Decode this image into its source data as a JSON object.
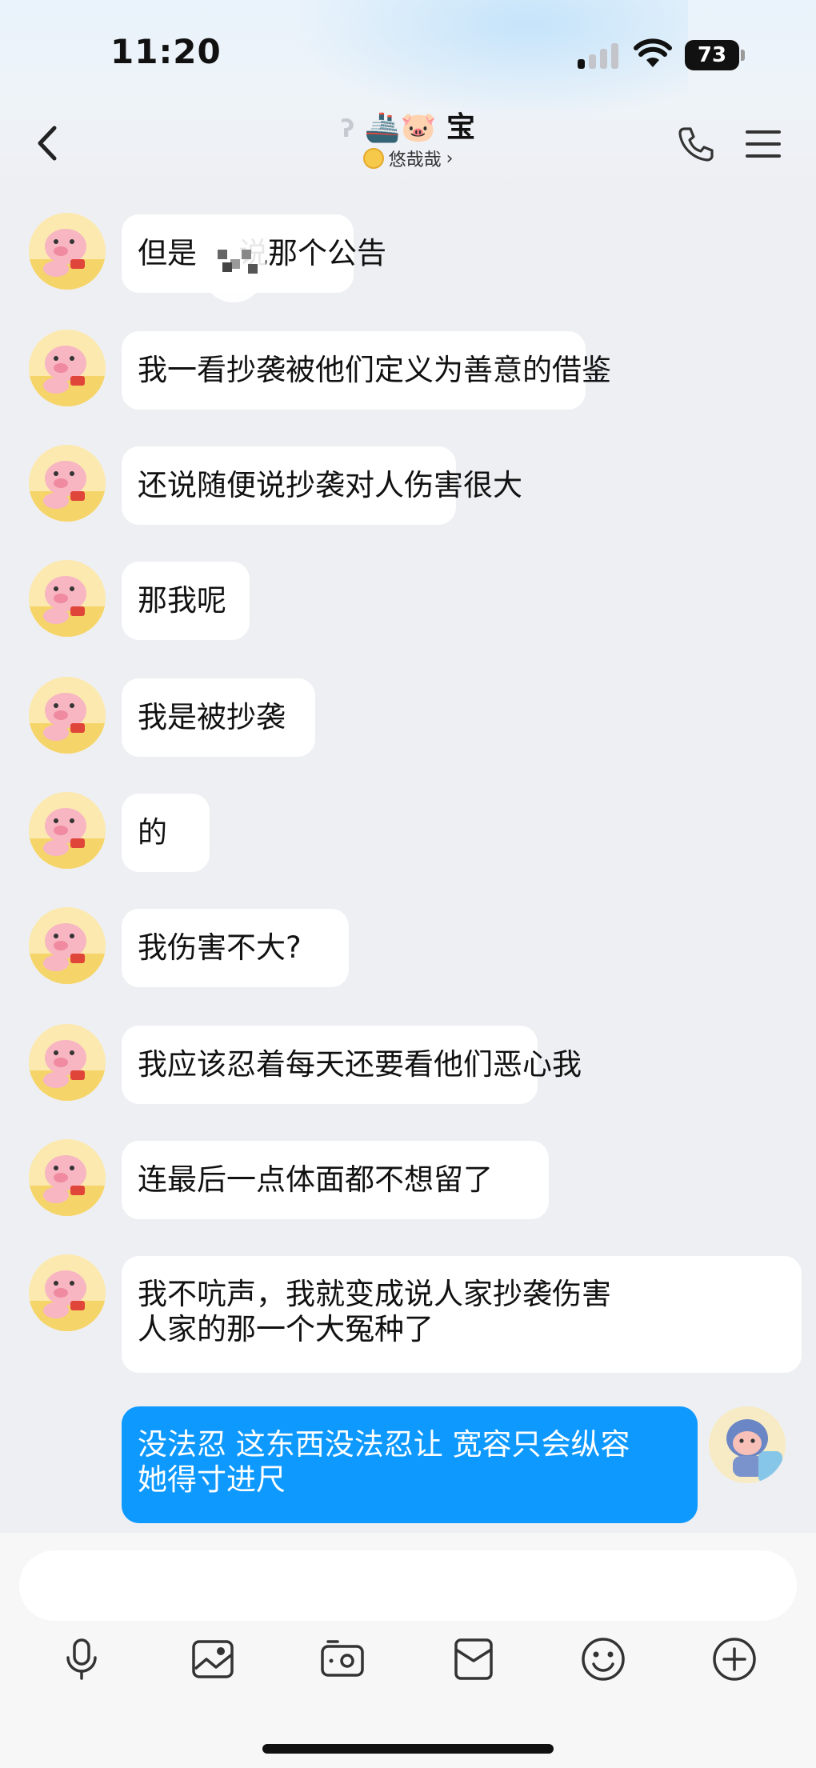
{
  "status_bar": {
    "time": "11:20",
    "battery": "73"
  },
  "header": {
    "title": "宝",
    "title_emojis": "🚢🐷",
    "subtitle": "悠哉哉",
    "subtitle_chevron": "›"
  },
  "messages": [
    {
      "side": "in",
      "lines": [
        "但是说那个公告"
      ]
    },
    {
      "side": "in",
      "lines": [
        "我一看抄袭被他们定义为善意的借鉴"
      ]
    },
    {
      "side": "in",
      "lines": [
        "还说随便说抄袭对人伤害很大"
      ]
    },
    {
      "side": "in",
      "lines": [
        "那我呢"
      ]
    },
    {
      "side": "in",
      "lines": [
        "我是被抄袭"
      ]
    },
    {
      "side": "in",
      "lines": [
        "的"
      ]
    },
    {
      "side": "in",
      "lines": [
        "我伤害不大?"
      ]
    },
    {
      "side": "in",
      "lines": [
        "我应该忍着每天还要看他们恶心我"
      ]
    },
    {
      "side": "in",
      "lines": [
        "连最后一点体面都不想留了"
      ]
    },
    {
      "side": "in",
      "lines": [
        "我不吭声，我就变成说人家抄袭伤害",
        "人家的那一个大冤种了"
      ]
    },
    {
      "side": "out",
      "lines": [
        "没法忍 这东西没法忍让 宽容只会纵容",
        "她得寸进尺"
      ]
    }
  ],
  "input": {
    "value": "",
    "placeholder": ""
  },
  "toolbar": [
    "microphone-icon",
    "image-icon",
    "camera-icon",
    "red-packet-icon",
    "emoji-icon",
    "plus-icon"
  ],
  "colors": {
    "outgoing_bubble": "#0e99ff",
    "incoming_bubble": "#ffffff",
    "background": "#eeeff3"
  }
}
